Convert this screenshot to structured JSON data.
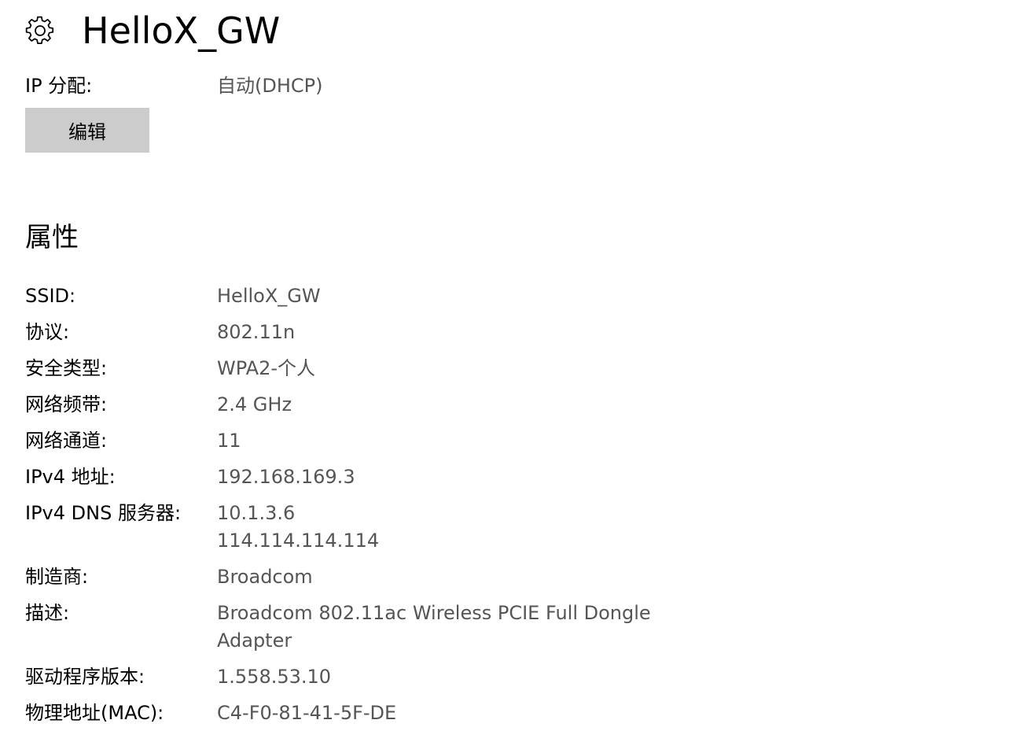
{
  "header": {
    "icon": "gear-icon",
    "title": "HelloX_GW"
  },
  "ip_assignment": {
    "label": "IP 分配:",
    "value": "自动(DHCP)",
    "edit_label": "编辑"
  },
  "properties": {
    "heading": "属性",
    "rows": [
      {
        "label": "SSID:",
        "values": [
          "HelloX_GW"
        ]
      },
      {
        "label": "协议:",
        "values": [
          "802.11n"
        ]
      },
      {
        "label": "安全类型:",
        "values": [
          "WPA2-个人"
        ]
      },
      {
        "label": "网络频带:",
        "values": [
          "2.4 GHz"
        ]
      },
      {
        "label": "网络通道:",
        "values": [
          "11"
        ]
      },
      {
        "label": "IPv4 地址:",
        "values": [
          "192.168.169.3"
        ]
      },
      {
        "label": "IPv4 DNS 服务器:",
        "values": [
          "10.1.3.6",
          "114.114.114.114"
        ]
      },
      {
        "label": "制造商:",
        "values": [
          "Broadcom"
        ]
      },
      {
        "label": "描述:",
        "values": [
          "Broadcom 802.11ac Wireless PCIE Full Dongle",
          "Adapter"
        ]
      },
      {
        "label": "驱动程序版本:",
        "values": [
          "1.558.53.10"
        ]
      },
      {
        "label": "物理地址(MAC):",
        "values": [
          "C4-F0-81-41-5F-DE"
        ]
      }
    ]
  },
  "colors": {
    "background": "#ffffff",
    "label_text": "#000000",
    "value_text": "#555555",
    "button_bg": "#cccccc"
  }
}
